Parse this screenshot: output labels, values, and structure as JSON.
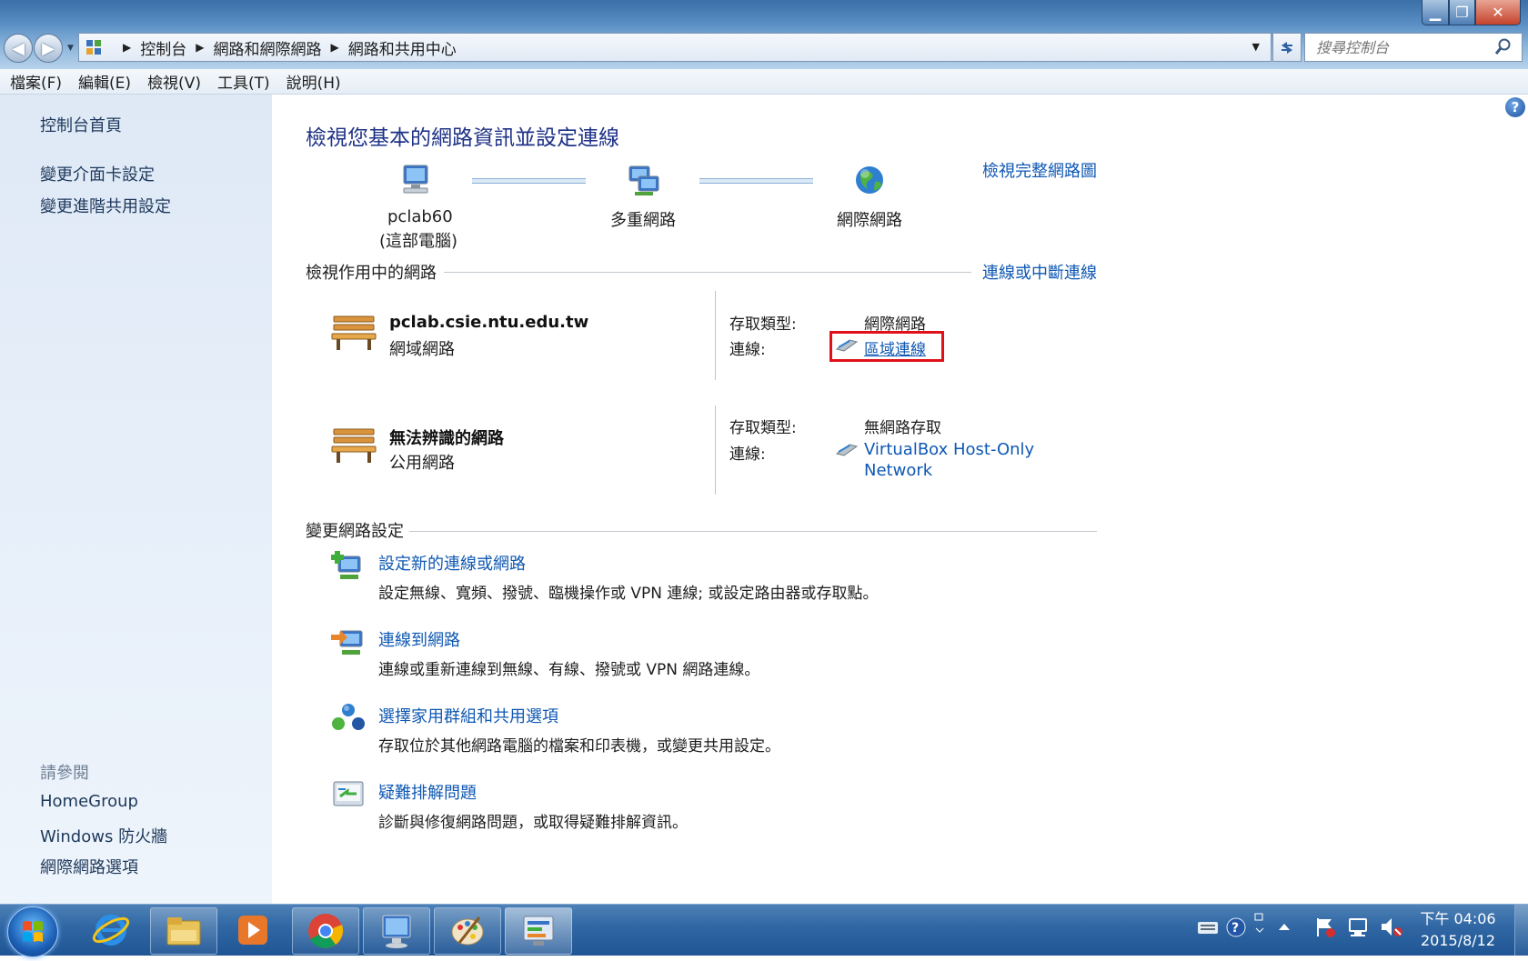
{
  "window": {
    "title": "網路和共用中心"
  },
  "address": {
    "crumbs": [
      "控制台",
      "網路和網際網路",
      "網路和共用中心"
    ],
    "search_placeholder": "搜尋控制台"
  },
  "menu": [
    "檔案(F)",
    "編輯(E)",
    "檢視(V)",
    "工具(T)",
    "說明(H)"
  ],
  "sidebar": {
    "home": "控制台首頁",
    "links": [
      "變更介面卡設定",
      "變更進階共用設定"
    ],
    "see_also_title": "請參閱",
    "see_also": [
      "HomeGroup",
      "Windows 防火牆",
      "網際網路選項"
    ]
  },
  "main": {
    "title": "檢視您基本的網路資訊並設定連線",
    "full_map_link": "檢視完整網路圖",
    "map": {
      "computer_name": "pclab60",
      "computer_sub": "(這部電腦)",
      "network": "多重網路",
      "internet": "網際網路"
    },
    "active_header": "檢視作用中的網路",
    "connect_link": "連線或中斷連線",
    "access_label": "存取類型:",
    "connection_label": "連線:",
    "networks": [
      {
        "name": "pclab.csie.ntu.edu.tw",
        "category": "網域網路",
        "access": "網際網路",
        "connection": "區域連線"
      },
      {
        "name": "無法辨識的網路",
        "category": "公用網路",
        "access": "無網路存取",
        "connection_line1": "VirtualBox Host-Only",
        "connection_line2": "Network"
      }
    ],
    "change_header": "變更網路設定",
    "tasks": [
      {
        "title": "設定新的連線或網路",
        "desc": "設定無線、寬頻、撥號、臨機操作或 VPN 連線; 或設定路由器或存取點。"
      },
      {
        "title": "連線到網路",
        "desc": "連線或重新連線到無線、有線、撥號或 VPN 網路連線。"
      },
      {
        "title": "選擇家用群組和共用選項",
        "desc": "存取位於其他網路電腦的檔案和印表機，或變更共用設定。"
      },
      {
        "title": "疑難排解問題",
        "desc": "診斷與修復網路問題，或取得疑難排解資訊。"
      }
    ]
  },
  "taskbar": {
    "clock_time": "下午 04:06",
    "clock_date": "2015/8/12"
  },
  "colors": {
    "link": "#0f58b3",
    "title": "#1e3287",
    "highlight": "#e0101a"
  }
}
